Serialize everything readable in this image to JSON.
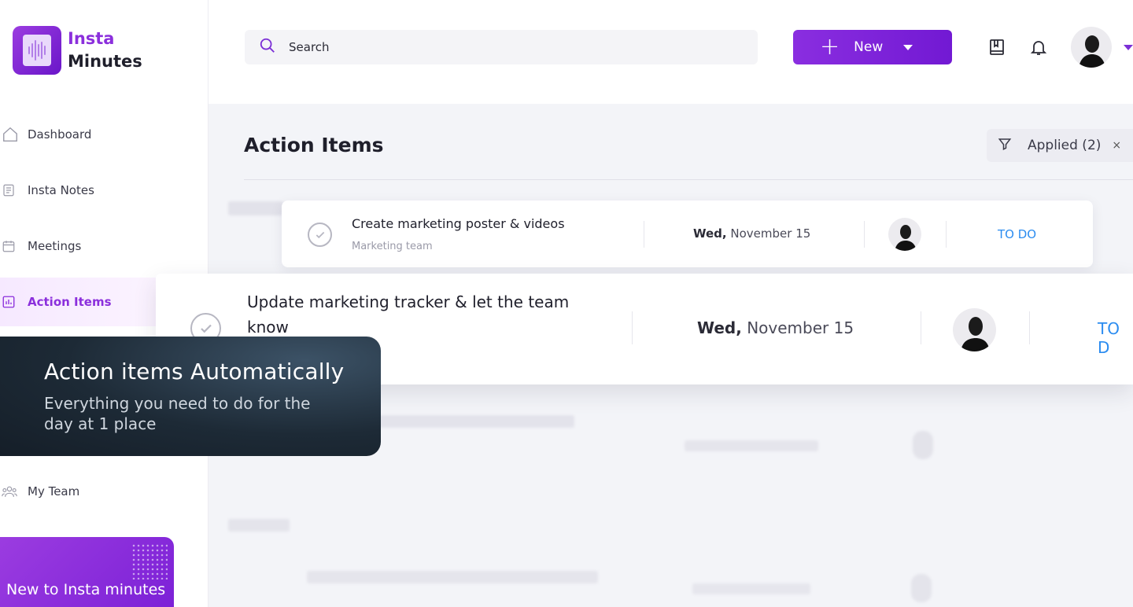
{
  "brand": {
    "line1": "Insta",
    "line2": "Minutes"
  },
  "nav": {
    "dashboard": "Dashboard",
    "notes": "Insta Notes",
    "meetings": "Meetings",
    "action_items": "Action Items",
    "my_team": "My Team"
  },
  "promo": {
    "title": "New to Insta minutes"
  },
  "search": {
    "placeholder": "Search"
  },
  "new_button": {
    "label": "New"
  },
  "page": {
    "title": "Action Items"
  },
  "filter": {
    "label": "Applied (2)",
    "clear": "×"
  },
  "items": [
    {
      "title": "Create marketing poster & videos",
      "team": "Marketing team",
      "weekday": "Wed,",
      "date": "November 15",
      "status": "TO DO"
    },
    {
      "title": "Update marketing tracker & let the team know",
      "weekday": "Wed,",
      "date": "November 15",
      "status": "TO D"
    }
  ],
  "tooltip": {
    "title": "Action items Automatically",
    "subtitle": "Everything you need to do for the day at 1 place"
  },
  "colors": {
    "accent": "#8b2fdc",
    "status": "#2b8cf0",
    "tooltip_bg": "#1d2a36"
  }
}
